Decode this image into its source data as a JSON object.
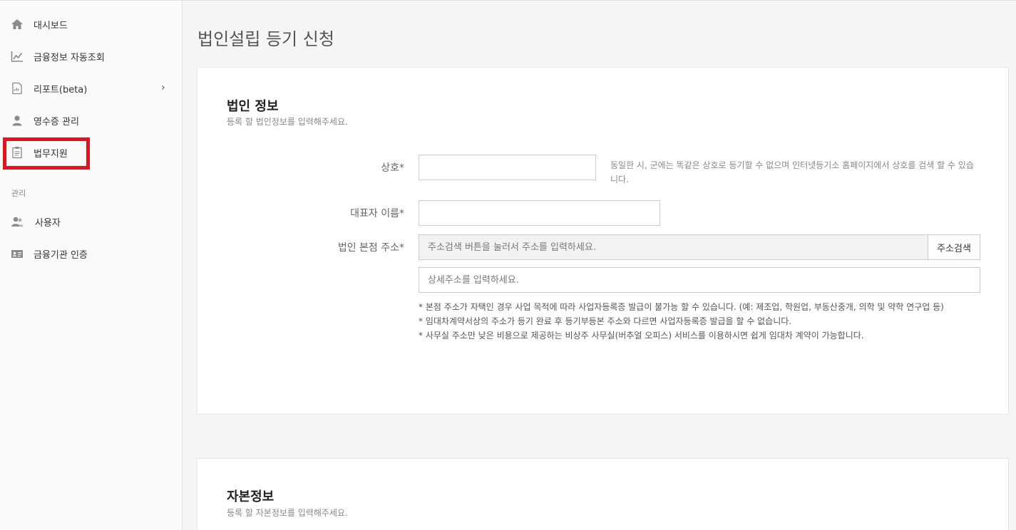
{
  "sidebar": {
    "items": [
      {
        "label": "대시보드",
        "icon": "home-icon"
      },
      {
        "label": "금융정보 자동조회",
        "icon": "line-chart-icon"
      },
      {
        "label": "리포트(beta)",
        "icon": "report-icon"
      },
      {
        "label": "영수증 관리",
        "icon": "user-icon"
      },
      {
        "label": "법무지원",
        "icon": "clipboard-icon"
      }
    ],
    "section_label": "관리",
    "admin_items": [
      {
        "label": "사용자",
        "icon": "users-icon"
      },
      {
        "label": "금융기관 인증",
        "icon": "id-card-icon"
      }
    ],
    "chevron": "›"
  },
  "main": {
    "title": "법인설립 등기 신청",
    "corp_card": {
      "title": "법인 정보",
      "subtitle": "등록 할 법인정보를 입력해주세요.",
      "name_label": "상호*",
      "name_help": "동일한 시, 군에는 똑같은 상호로 등기할 수 없으며 인터넷등기소 홈페이지에서 상호를 검색 할 수 있습니다.",
      "rep_label": "대표자 이름*",
      "addr_label": "법인 본점 주소*",
      "addr_placeholder": "주소검색 버튼을 눌러서 주소를 입력하세요.",
      "addr_button": "주소검색",
      "detail_placeholder": "상세주소를 입력하세요.",
      "notes": [
        "* 본점 주소가 자택인 경우 사업 목적에 따라 사업자등록증 발급이 불가능 할 수 있습니다. (예: 제조업, 학원업, 부동산중개, 의학 및 약학 연구업 등)",
        "* 임대차계약서상의 주소가 등기 완료 후 등기부등본 주소와 다르면 사업자등록증 발급을 할 수 없습니다.",
        "* 사무실 주소만 낮은 비용으로 제공하는 비상주 사무실(버추얼 오피스) 서비스를 이용하시면 쉽게 임대차 계약이 가능합니다."
      ]
    },
    "capital_card": {
      "title": "자본정보",
      "subtitle": "등록 할 자본정보를 입력해주세요."
    }
  },
  "colors": {
    "highlight": "#e3131b",
    "sidebar_bg": "#fafafa",
    "page_bg": "#f5f5f5"
  }
}
